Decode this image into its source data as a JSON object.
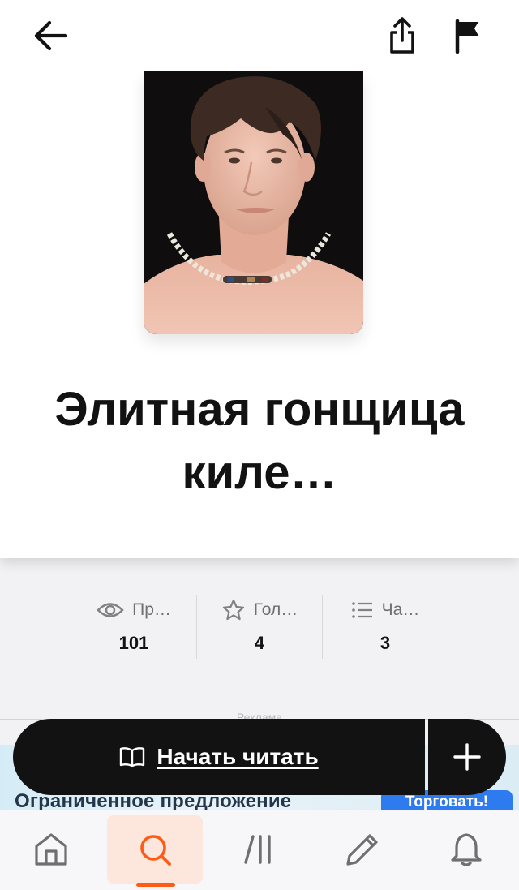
{
  "header": {
    "back_icon": "arrow-left-icon",
    "share_icon": "share-icon",
    "report_icon": "flag-icon"
  },
  "story": {
    "title": "Элитная гонщица киле…",
    "cover_description_icon": "cover-image"
  },
  "stats": [
    {
      "icon": "eye-icon",
      "label": "Пр…",
      "value": "101"
    },
    {
      "icon": "star-icon",
      "label": "Гол…",
      "value": "4"
    },
    {
      "icon": "list-icon",
      "label": "Ча…",
      "value": "3"
    }
  ],
  "ad": {
    "label": "Реклама",
    "text": "Ограниченное предложение",
    "button": "Торговать!"
  },
  "cta": {
    "read_label": "Начать читать",
    "read_icon": "book-open-icon",
    "add_icon": "plus-icon"
  },
  "nav": {
    "items": [
      "home-icon",
      "search-icon",
      "library-icon",
      "pencil-icon",
      "bell-icon"
    ],
    "active": "search",
    "accent_color": "#ff5a16"
  }
}
